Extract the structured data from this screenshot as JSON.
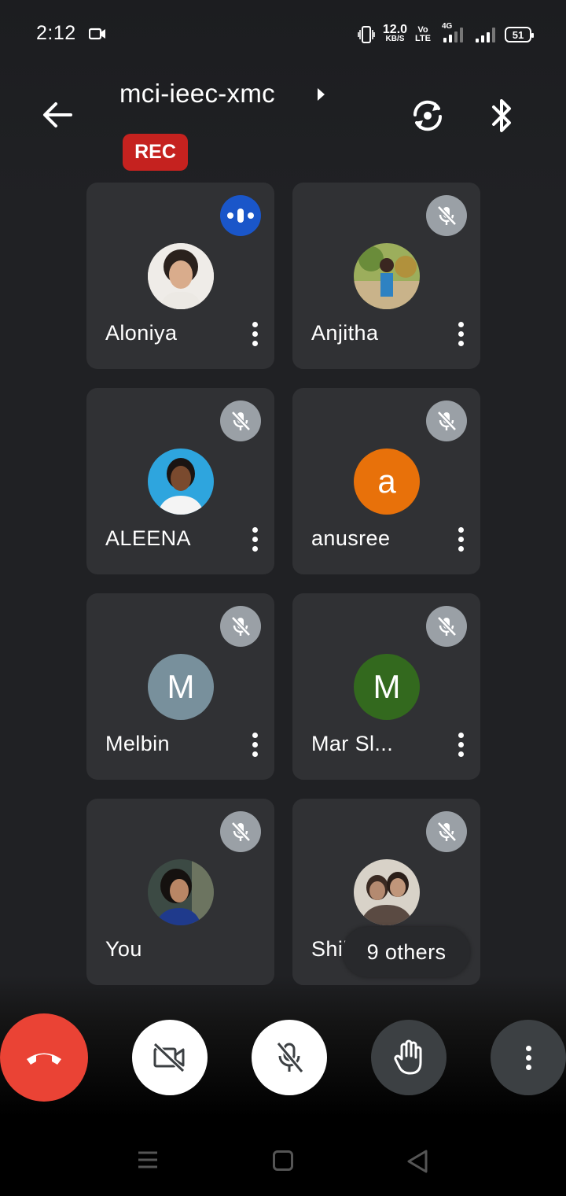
{
  "status_bar": {
    "time": "2:12",
    "net_speed": "12.0",
    "net_unit": "KB/S",
    "volte_top": "Vo",
    "volte_bottom": "LTE",
    "network": "4G",
    "battery": "51"
  },
  "header": {
    "meeting_code": "mci-ieec-xmc",
    "rec_label": "REC"
  },
  "participants": [
    {
      "name": "Aloniya",
      "avatar_type": "photo",
      "status": "speaking"
    },
    {
      "name": "Anjitha",
      "avatar_type": "photo",
      "status": "muted"
    },
    {
      "name": "ALEENA",
      "avatar_type": "photo",
      "status": "muted"
    },
    {
      "name": "anusree",
      "avatar_type": "letter",
      "initial": "a",
      "color": "#e8710a",
      "status": "muted"
    },
    {
      "name": "Melbin",
      "avatar_type": "letter",
      "initial": "M",
      "color": "#78909c",
      "status": "muted"
    },
    {
      "name": "Mar Sl...",
      "avatar_type": "letter",
      "initial": "M",
      "color": "#33691e",
      "status": "muted"
    },
    {
      "name": "You",
      "avatar_type": "photo",
      "status": "muted"
    },
    {
      "name": "Shibin",
      "avatar_type": "photo",
      "status": "muted"
    }
  ],
  "others_chip": "9 others",
  "controls": {
    "end_call_icon": "phone-hangup-icon",
    "camera_icon": "video-off-icon",
    "mic_icon": "mic-off-icon",
    "hand_icon": "hand-raise-icon",
    "more_icon": "more-vert-icon"
  },
  "colors": {
    "background": "#202124",
    "tile": "#303134",
    "rec": "#c5221f",
    "end_call": "#ea4335",
    "speaking": "#1a56c9",
    "muted_badge": "#9aa0a6"
  }
}
